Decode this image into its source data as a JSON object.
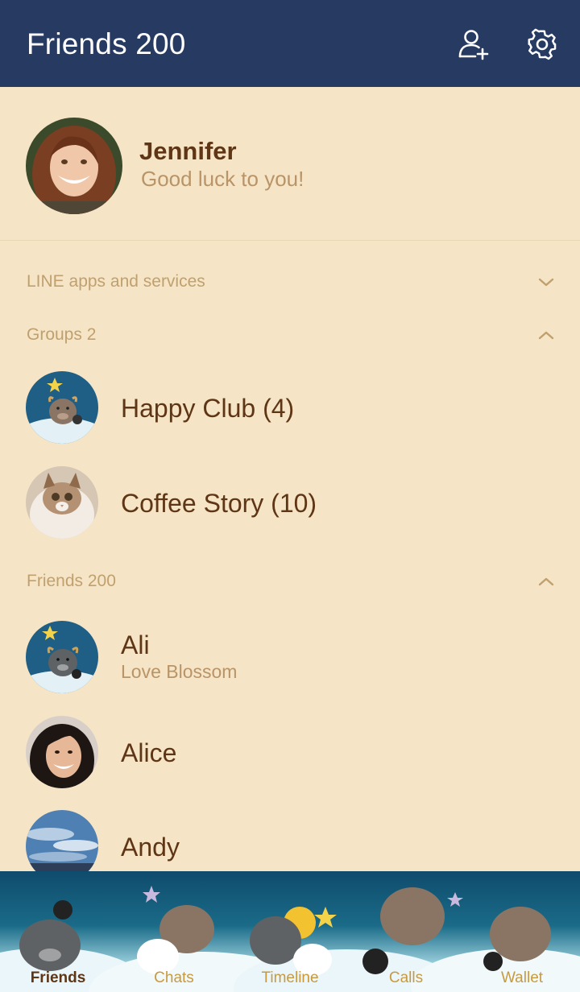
{
  "header": {
    "title": "Friends 200"
  },
  "profile": {
    "name": "Jennifer",
    "status": "Good luck to you!"
  },
  "sections": {
    "services": "LINE apps and services",
    "groups": "Groups 2",
    "friends": "Friends 200"
  },
  "groups": [
    {
      "name": "Happy Club (4)"
    },
    {
      "name": "Coffee Story (10)"
    }
  ],
  "friends": [
    {
      "name": "Ali",
      "status": "Love Blossom"
    },
    {
      "name": "Alice",
      "status": ""
    },
    {
      "name": "Andy",
      "status": ""
    }
  ],
  "tabs": [
    {
      "label": "Friends"
    },
    {
      "label": "Chats"
    },
    {
      "label": "Timeline"
    },
    {
      "label": "Calls"
    },
    {
      "label": "Wallet"
    }
  ],
  "colors": {
    "header_bg": "#273b62",
    "page_bg": "#f5e5c6",
    "name_text": "#5e3616",
    "muted_text": "#b89468"
  }
}
